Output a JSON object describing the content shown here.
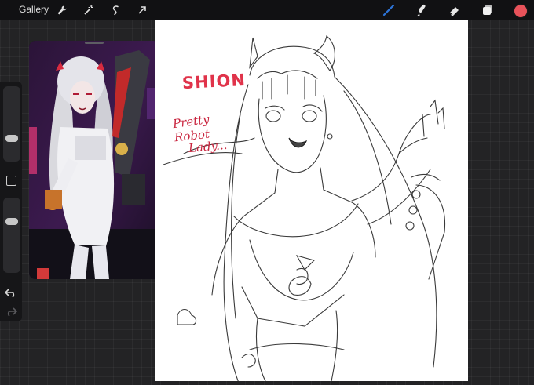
{
  "topbar": {
    "gallery_label": "Gallery",
    "left_tools": [
      "wrench-icon",
      "magic-wand-icon",
      "selection-icon",
      "transform-arrow-icon"
    ],
    "right_tools": [
      "brush-icon",
      "smudge-icon",
      "eraser-icon",
      "layers-icon"
    ],
    "active_tool": "brush-icon",
    "current_color": "#e8525a",
    "active_tool_color": "#2d74d8"
  },
  "sidebar": {
    "brush_size": 0.68,
    "opacity": 0.74,
    "buttons": [
      "modify-button",
      "undo-button",
      "redo-button"
    ]
  },
  "reference": {
    "description_icon": "reference-window",
    "character": "robot-girl-render"
  },
  "canvas": {
    "title_text": "SHION",
    "note_lines": [
      "Pretty",
      "Robot",
      "Lady..."
    ],
    "ink_color": "#d02c46"
  }
}
